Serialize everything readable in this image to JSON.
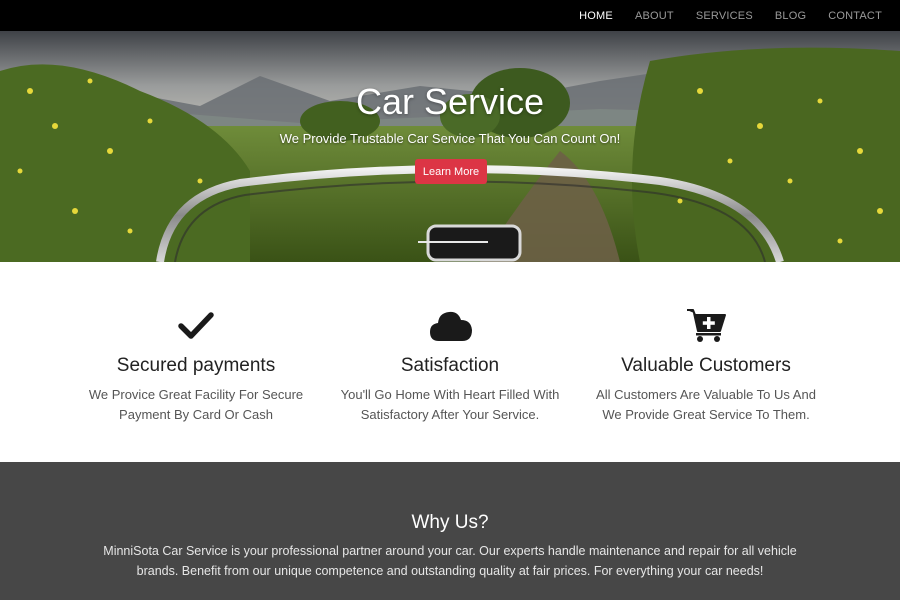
{
  "nav": {
    "items": [
      {
        "label": "HOME",
        "active": true
      },
      {
        "label": "ABOUT",
        "active": false
      },
      {
        "label": "SERVICES",
        "active": false
      },
      {
        "label": "BLOG",
        "active": false
      },
      {
        "label": "CONTACT",
        "active": false
      }
    ]
  },
  "hero": {
    "title": "Car Service",
    "subtitle": "We Provide Trustable Car Service That You Can Count On!",
    "button_label": "Learn More",
    "button_color": "#dc3545"
  },
  "features": [
    {
      "icon": "checkmark-icon",
      "title": "Secured payments",
      "desc": "We Provice Great Facility For Secure Payment By Card Or Cash"
    },
    {
      "icon": "cloud-icon",
      "title": "Satisfaction",
      "desc": "You'll Go Home With Heart Filled With Satisfactory After Your Service."
    },
    {
      "icon": "cart-plus-icon",
      "title": "Valuable Customers",
      "desc": "All Customers Are Valuable To Us And We Provide Great Service To Them."
    }
  ],
  "why": {
    "title": "Why Us?",
    "text": "MinniSota Car Service is your professional partner around your car. Our experts handle maintenance and repair for all vehicle brands. Benefit from our unique competence and outstanding quality at fair prices. For everything your car needs!"
  },
  "colors": {
    "navbar": "#000000",
    "why_background": "#474747",
    "accent": "#dc3545"
  }
}
